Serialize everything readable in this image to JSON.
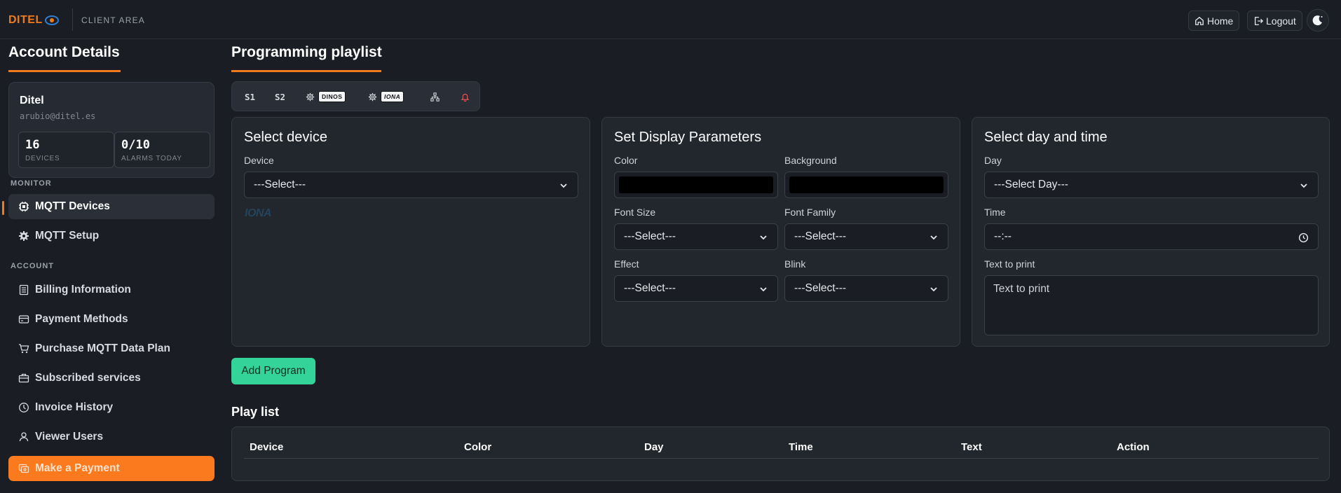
{
  "header": {
    "logo_text": "DITEL",
    "client_area": "CLIENT AREA",
    "home_label": "Home",
    "logout_label": "Logout"
  },
  "sidebar": {
    "title": "Account Details",
    "account": {
      "name": "Ditel",
      "email": "arubio@ditel.es",
      "stats": [
        {
          "value": "16",
          "label": "DEVICES"
        },
        {
          "value": "0/10",
          "label": "ALARMS TODAY"
        }
      ]
    },
    "monitor_label": "MONITOR",
    "monitor_items": [
      {
        "label": "MQTT Devices",
        "icon": "chip-icon"
      },
      {
        "label": "MQTT Setup",
        "icon": "gear-icon"
      }
    ],
    "account_label": "ACCOUNT",
    "account_items": [
      {
        "label": "Billing Information",
        "icon": "document-icon"
      },
      {
        "label": "Payment Methods",
        "icon": "credit-card-icon"
      },
      {
        "label": "Purchase MQTT Data Plan",
        "icon": "cart-icon"
      },
      {
        "label": "Subscribed services",
        "icon": "briefcase-icon"
      },
      {
        "label": "Invoice History",
        "icon": "clock-icon"
      },
      {
        "label": "Viewer Users",
        "icon": "user-icon"
      }
    ],
    "payment_label": "Make a Payment"
  },
  "main": {
    "title": "Programming playlist",
    "tabs": [
      {
        "label": "S1"
      },
      {
        "label": "S2"
      },
      {
        "label": "DINOS",
        "icon": "gear-icon"
      },
      {
        "label": "IONA",
        "icon": "gear-icon"
      },
      {
        "icon": "network-icon"
      },
      {
        "icon": "bell-icon"
      }
    ],
    "device_panel": {
      "title": "Select device",
      "device_label": "Device",
      "device_value": "---Select---",
      "brand_mark": "IONA"
    },
    "display_panel": {
      "title": "Set Display Parameters",
      "color_label": "Color",
      "color_value": "#000000",
      "background_label": "Background",
      "background_value": "#000000",
      "font_size_label": "Font Size",
      "font_size_value": "---Select---",
      "font_family_label": "Font Family",
      "font_family_value": "---Select---",
      "effect_label": "Effect",
      "effect_value": "---Select---",
      "blink_label": "Blink",
      "blink_value": "---Select---"
    },
    "time_panel": {
      "title": "Select day and time",
      "day_label": "Day",
      "day_value": "---Select Day---",
      "time_label": "Time",
      "time_value": "--:--",
      "text_label": "Text to print",
      "text_placeholder": "Text to print"
    },
    "add_button": "Add Program",
    "playlist": {
      "title": "Play list",
      "columns": [
        "Device",
        "Color",
        "Day",
        "Time",
        "Text",
        "Action"
      ]
    }
  },
  "colors": {
    "accent": "#f07a1e",
    "success": "#34d399",
    "background": "#1a1d23"
  }
}
